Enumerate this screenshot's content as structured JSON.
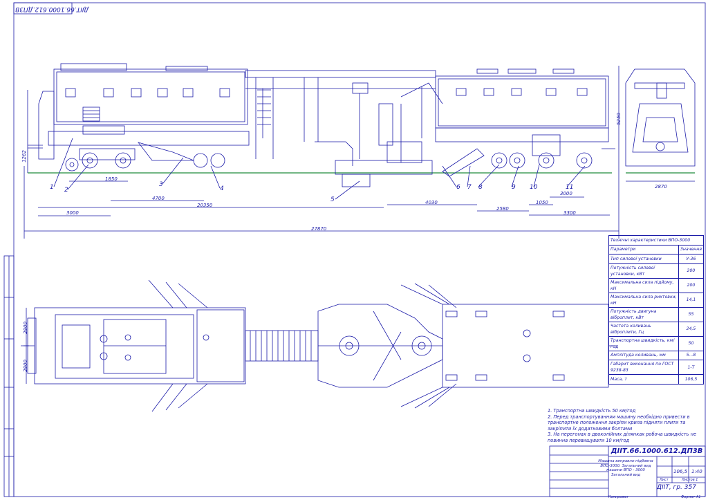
{
  "drawing": {
    "mirrored_code": "ДІІТ.66.1000.612.ДП3В",
    "code": "ДІІТ.66.1000.612.ДП3В",
    "group": "ДІІТ, гр. 357",
    "description": "Машина виправно-підбивна ВПО-3000. Загальний вид машини ВПО - 3000",
    "subtitle": "Загальний вид",
    "mass": "106,5",
    "scale": "1:40",
    "sheet": "Лист",
    "sheets": "Листов 1",
    "format": "Формат А1",
    "copied": "Копировал"
  },
  "dimensions": {
    "d1": "3000",
    "d2": "1850",
    "d3": "4700",
    "d4": "20350",
    "d5": "27870",
    "d6": "4030",
    "d7": "2580",
    "d8": "1050",
    "d9": "3300",
    "d10": "3000",
    "h1": "1262",
    "h2": "5250",
    "w1": "2870",
    "p1": "2800",
    "p2": "2800"
  },
  "callouts": [
    "1",
    "2",
    "3",
    "4",
    "5",
    "6",
    "7",
    "8",
    "9",
    "10",
    "11"
  ],
  "params": {
    "title": "Технічні характеристики ВПО-3000",
    "header": [
      "Параметри",
      "Значення"
    ],
    "rows": [
      [
        "Тип силової установки",
        "У-36"
      ],
      [
        "Потужність силової установки, кВт",
        "200"
      ],
      [
        "Максимальна сила підйому, кН",
        "200"
      ],
      [
        "Максимальна сила рихтовки, кН",
        "14,1"
      ],
      [
        "Потужність двигуна віброплит, кВт",
        "55"
      ],
      [
        "Частота коливань віброплити, Гц",
        "24,5"
      ],
      [
        "Транспортна швидкість, км/год",
        "50"
      ],
      [
        "Амплітуда коливань, мм",
        "5...8"
      ],
      [
        "Габарит виконання по ГОСТ 9238-83",
        "1-Т"
      ],
      [
        "Маса, т",
        "106,5"
      ]
    ]
  },
  "notes": [
    "1. Транспортна швидкість 50 км/год",
    "2. Перед транспортуванням машину необхідно привести в транспортне положення закріпи крила підняти плити та закріпити їх додатковими болтами",
    "3. На перегонах в двоколійних ділянках робоча швидкість не повинна перевищувати 10 км/год"
  ],
  "colors": {
    "ink": "#1a1aa8",
    "rail": "#1f8a3a"
  }
}
